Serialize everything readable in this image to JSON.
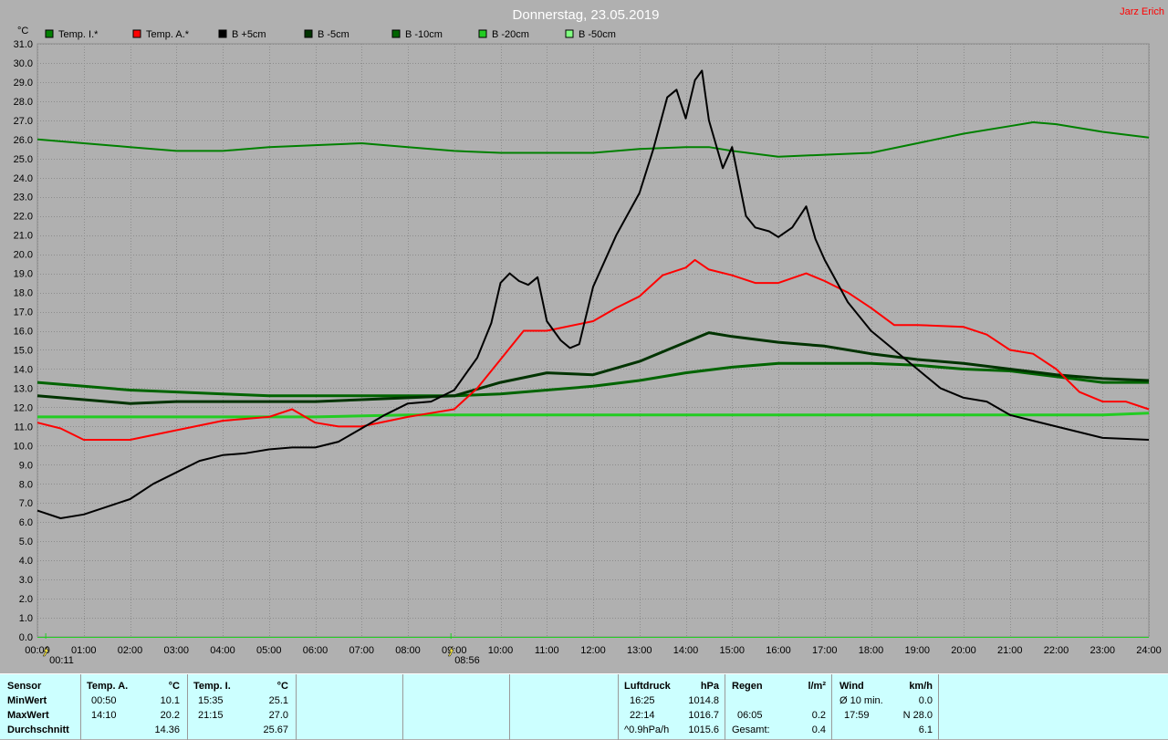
{
  "title": "Donnerstag, 23.05.2019",
  "author": "Jarz Erich",
  "colors": {
    "background": "#b0b0b0",
    "grid": "#8c8c8c",
    "title": "#ffffff",
    "author": "#ff0000",
    "panel": "#ccffff"
  },
  "chart_data": {
    "type": "line",
    "title": "Donnerstag, 23.05.2019",
    "ylabel": "°C",
    "xlim": [
      0,
      24
    ],
    "ylim": [
      0,
      31
    ],
    "grid": true,
    "legend_position": "top",
    "y_ticks": [
      "0.0",
      "1.0",
      "2.0",
      "3.0",
      "4.0",
      "5.0",
      "6.0",
      "7.0",
      "8.0",
      "9.0",
      "10.0",
      "11.0",
      "12.0",
      "13.0",
      "14.0",
      "15.0",
      "16.0",
      "17.0",
      "18.0",
      "19.0",
      "20.0",
      "21.0",
      "22.0",
      "23.0",
      "24.0",
      "25.0",
      "26.0",
      "27.0",
      "28.0",
      "29.0",
      "30.0",
      "31.0"
    ],
    "x_ticks": [
      "00:00",
      "01:00",
      "02:00",
      "03:00",
      "04:00",
      "05:00",
      "06:00",
      "07:00",
      "08:00",
      "09:00",
      "10:00",
      "11:00",
      "12:00",
      "13:00",
      "14:00",
      "15:00",
      "16:00",
      "17:00",
      "18:00",
      "19:00",
      "20:00",
      "21:00",
      "22:00",
      "23:00",
      "24:00"
    ],
    "markers": [
      {
        "label": "00:11",
        "x": 0.18
      },
      {
        "label": "08:56",
        "x": 8.93
      }
    ],
    "series": [
      {
        "name": "Temp. I.*",
        "color": "#008000",
        "x": [
          0,
          1,
          2,
          3,
          4,
          5,
          6,
          7,
          8,
          9,
          10,
          11,
          12,
          13,
          14,
          14.5,
          15,
          16,
          17,
          18,
          19,
          20,
          21,
          21.5,
          22,
          23,
          24
        ],
        "y": [
          26.0,
          25.8,
          25.6,
          25.4,
          25.4,
          25.6,
          25.7,
          25.8,
          25.6,
          25.4,
          25.3,
          25.3,
          25.3,
          25.5,
          25.6,
          25.6,
          25.4,
          25.1,
          25.2,
          25.3,
          25.8,
          26.3,
          26.7,
          26.9,
          26.8,
          26.4,
          26.1
        ]
      },
      {
        "name": "Temp. A.*",
        "color": "#ff0000",
        "x": [
          0,
          0.5,
          1,
          2,
          3,
          4,
          5,
          5.5,
          6,
          6.5,
          7,
          8,
          8.5,
          9,
          9.5,
          10,
          10.5,
          11,
          12,
          12.5,
          13,
          13.5,
          14,
          14.2,
          14.5,
          15,
          15.5,
          16,
          16.6,
          17,
          17.5,
          18,
          18.5,
          19,
          20,
          20.5,
          21,
          21.5,
          22,
          22.5,
          23,
          23.5,
          24
        ],
        "y": [
          11.2,
          10.9,
          10.3,
          10.3,
          10.8,
          11.3,
          11.5,
          11.9,
          11.2,
          11.0,
          11.0,
          11.5,
          11.7,
          11.9,
          13.0,
          14.5,
          16.0,
          16.0,
          16.5,
          17.2,
          17.8,
          18.9,
          19.3,
          19.7,
          19.2,
          18.9,
          18.5,
          18.5,
          19.0,
          18.6,
          18.0,
          17.2,
          16.3,
          16.3,
          16.2,
          15.8,
          15.0,
          14.8,
          14.0,
          12.8,
          12.3,
          12.3,
          11.9
        ]
      },
      {
        "name": "B +5cm",
        "color": "#000000",
        "x": [
          0,
          0.5,
          1,
          1.5,
          2,
          2.5,
          3,
          3.5,
          4,
          4.5,
          5,
          5.5,
          6,
          6.5,
          7,
          7.5,
          8,
          8.5,
          9,
          9.5,
          9.8,
          10,
          10.2,
          10.4,
          10.6,
          10.8,
          11,
          11.3,
          11.5,
          11.7,
          12,
          12.5,
          13,
          13.3,
          13.6,
          13.8,
          14.0,
          14.2,
          14.35,
          14.5,
          14.8,
          15,
          15.3,
          15.5,
          15.8,
          16.0,
          16.3,
          16.6,
          16.8,
          17,
          17.5,
          18,
          18.5,
          19,
          19.5,
          20,
          20.5,
          21,
          21.5,
          22,
          22.5,
          23,
          24
        ],
        "y": [
          6.6,
          6.2,
          6.4,
          6.8,
          7.2,
          8.0,
          8.6,
          9.2,
          9.5,
          9.6,
          9.8,
          9.9,
          9.9,
          10.2,
          10.9,
          11.6,
          12.2,
          12.3,
          12.9,
          14.6,
          16.4,
          18.5,
          19.0,
          18.6,
          18.4,
          18.8,
          16.5,
          15.5,
          15.1,
          15.3,
          18.3,
          21.0,
          23.2,
          25.5,
          28.2,
          28.6,
          27.1,
          29.1,
          29.6,
          27.0,
          24.5,
          25.6,
          22.0,
          21.4,
          21.2,
          20.9,
          21.4,
          22.5,
          20.8,
          19.7,
          17.5,
          16.0,
          15.0,
          14.0,
          13.0,
          12.5,
          12.3,
          11.6,
          11.3,
          11.0,
          10.7,
          10.4,
          10.3
        ]
      },
      {
        "name": "B -5cm",
        "color": "#003300",
        "x": [
          0,
          1,
          2,
          3,
          4,
          5,
          6,
          7,
          8,
          9,
          10,
          11,
          12,
          13,
          14,
          14.5,
          15,
          16,
          17,
          18,
          19,
          20,
          21,
          22,
          23,
          24
        ],
        "y": [
          12.6,
          12.4,
          12.2,
          12.3,
          12.3,
          12.3,
          12.3,
          12.4,
          12.5,
          12.6,
          13.3,
          13.8,
          13.7,
          14.4,
          15.4,
          15.9,
          15.7,
          15.4,
          15.2,
          14.8,
          14.5,
          14.3,
          14.0,
          13.7,
          13.5,
          13.4
        ]
      },
      {
        "name": "B -10cm",
        "color": "#006400",
        "x": [
          0,
          1,
          2,
          3,
          4,
          5,
          6,
          7,
          8,
          9,
          10,
          11,
          12,
          13,
          14,
          15,
          16,
          17,
          18,
          19,
          20,
          21,
          22,
          23,
          24
        ],
        "y": [
          13.3,
          13.1,
          12.9,
          12.8,
          12.7,
          12.6,
          12.6,
          12.6,
          12.6,
          12.6,
          12.7,
          12.9,
          13.1,
          13.4,
          13.8,
          14.1,
          14.3,
          14.3,
          14.3,
          14.2,
          14.0,
          13.9,
          13.6,
          13.3,
          13.3
        ]
      },
      {
        "name": "B -20cm",
        "color": "#22cc22",
        "x": [
          0,
          2,
          4,
          6,
          8,
          10,
          12,
          14,
          16,
          18,
          20,
          22,
          23,
          24
        ],
        "y": [
          11.5,
          11.5,
          11.5,
          11.5,
          11.6,
          11.6,
          11.6,
          11.6,
          11.6,
          11.6,
          11.6,
          11.6,
          11.6,
          11.7
        ]
      },
      {
        "name": "B -50cm",
        "color": "#80ff80",
        "x": [],
        "y": []
      }
    ]
  },
  "stats": {
    "sensor": {
      "header": "Sensor",
      "rows": [
        "MinWert",
        "MaxWert",
        "Durchschnitt"
      ]
    },
    "temp_a": {
      "header": "Temp. A.",
      "unit": "°C",
      "min_time": "00:50",
      "min_val": "10.1",
      "max_time": "14:10",
      "max_val": "20.2",
      "avg": "14.36"
    },
    "temp_i": {
      "header": "Temp. I.",
      "unit": "°C",
      "min_time": "15:35",
      "min_val": "25.1",
      "max_time": "21:15",
      "max_val": "27.0",
      "avg": "25.67"
    },
    "luftdruck": {
      "header": "Luftdruck",
      "unit": "hPa",
      "r1_time": "16:25",
      "r1_val": "1014.8",
      "r2_time": "22:14",
      "r2_val": "1016.7",
      "r3_label": "^0.9hPa/h",
      "r3_val": "1015.6"
    },
    "regen": {
      "header": "Regen",
      "unit": "l/m²",
      "r2_time": "06:05",
      "r2_val": "0.2",
      "r3_label": "Gesamt:",
      "r3_val": "0.4"
    },
    "wind": {
      "header": "Wind",
      "unit": "km/h",
      "r1_label": "Ø 10 min.",
      "r1_val": "0.0",
      "r2_time": "17:59",
      "r2_val": "N 28.0",
      "r3_val": "6.1"
    }
  }
}
